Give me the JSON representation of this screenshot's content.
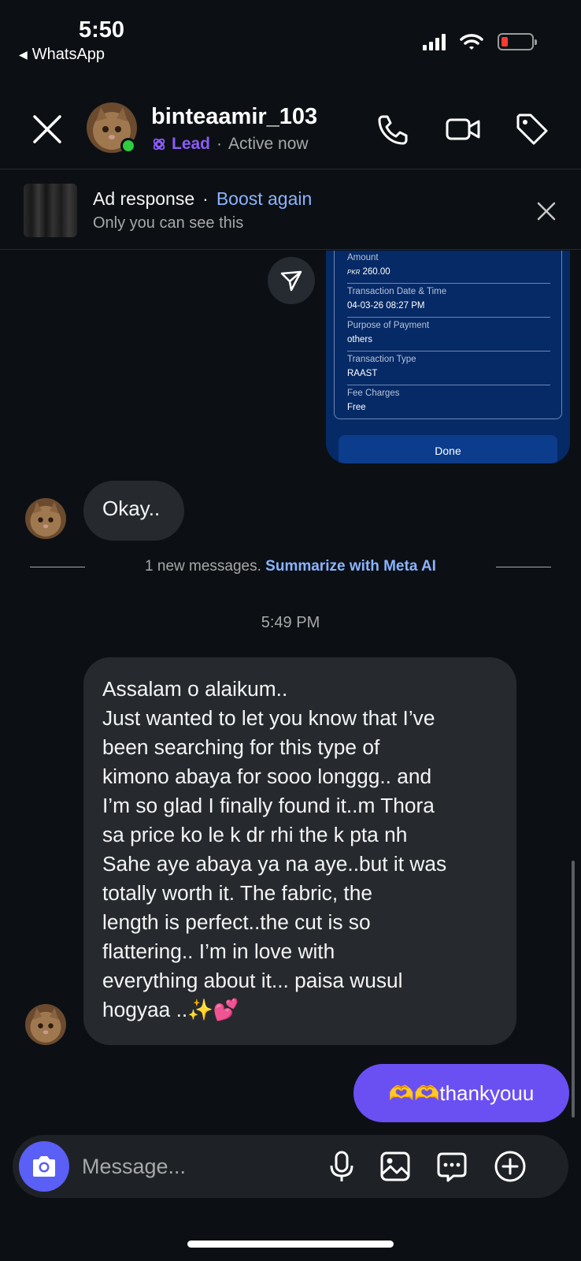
{
  "status_bar": {
    "time": "5:50",
    "back_app": "WhatsApp"
  },
  "header": {
    "username": "binteaamir_103",
    "label": "Lead",
    "separator": "·",
    "activity": "Active now"
  },
  "ad_banner": {
    "title": "Ad response",
    "separator": "·",
    "action": "Boost again",
    "subtitle": "Only you can see this"
  },
  "receipt": {
    "rows": [
      {
        "label": "Amount",
        "currency": "PKR",
        "value": "260.00"
      },
      {
        "label": "Transaction Date & Time",
        "value": "04-03-26 08:27 PM"
      },
      {
        "label": "Purpose of Payment",
        "value": "others"
      },
      {
        "label": "Transaction Type",
        "value": "RAAST"
      },
      {
        "label": "Fee Charges",
        "value": "Free"
      }
    ],
    "done_label": "Done"
  },
  "messages": {
    "okay": "Okay..",
    "new_messages_text": "1 new messages. ",
    "summarize_label": "Summarize with Meta AI",
    "timestamp": "5:49 PM",
    "long_lines": [
      "Assalam o alaikum..",
      "Just wanted to let you know that I’ve",
      "been searching for this type of",
      "kimono abaya for sooo longgg.. and",
      "I’m so glad I finally found it..m Thora",
      "sa price ko le k dr rhi the k pta nh",
      "Sahe aye abaya ya na aye..but it was",
      "totally worth it. The fabric, the",
      "length is perfect..the cut is so",
      "flattering.. I’m in love with",
      "everything about it... paisa wusul",
      "hogyaa ..✨💕"
    ],
    "outgoing": "🫶🫶thankyouu"
  },
  "composer": {
    "placeholder": "Message..."
  },
  "colors": {
    "accent": "#6a4ff3",
    "link": "#8ab4ff",
    "lead": "#8b5cf6",
    "online": "#2ecc40"
  }
}
